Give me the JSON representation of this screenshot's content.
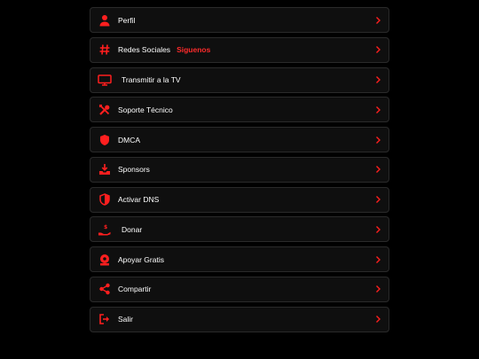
{
  "menu": {
    "items": [
      {
        "label": "Perfil",
        "icon": "user-icon"
      },
      {
        "label": "Redes Sociales",
        "extra": "Siguenos",
        "icon": "hash-icon"
      },
      {
        "label": "Transmitir a la TV",
        "icon": "tv-icon"
      },
      {
        "label": "Soporte Técnico",
        "icon": "tools-icon"
      },
      {
        "label": "DMCA",
        "icon": "shield-icon"
      },
      {
        "label": "Sponsors",
        "icon": "download-tray-icon"
      },
      {
        "label": "Activar DNS",
        "icon": "shield-half-icon"
      },
      {
        "label": "Donar",
        "icon": "hand-coin-icon"
      },
      {
        "label": "Apoyar Gratis",
        "icon": "badge-icon"
      },
      {
        "label": "Compartir",
        "icon": "share-icon"
      },
      {
        "label": "Salir",
        "icon": "logout-icon"
      }
    ]
  },
  "colors": {
    "accent": "#ff1f1f",
    "background": "#000000",
    "item_background": "#0f0f0f",
    "item_border": "#2a2a2a"
  }
}
